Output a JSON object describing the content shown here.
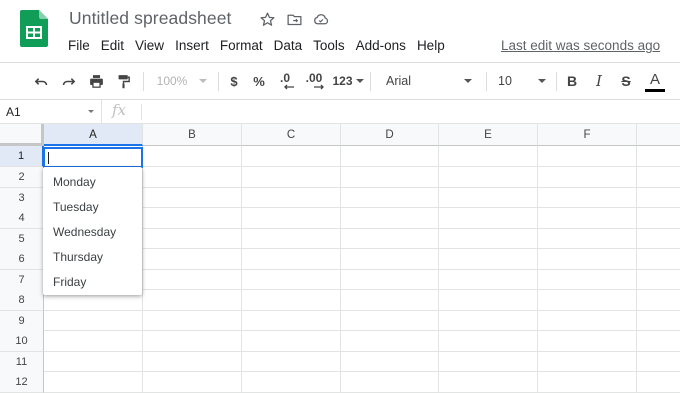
{
  "app": {
    "title": "Untitled spreadsheet",
    "last_edit": "Last edit was seconds ago",
    "brand_color": "#0f9d58"
  },
  "menu": [
    "File",
    "Edit",
    "View",
    "Insert",
    "Format",
    "Data",
    "Tools",
    "Add-ons",
    "Help"
  ],
  "toolbar": {
    "zoom": "100%",
    "currency": "$",
    "percent": "%",
    "decrease_decimal": ".0",
    "increase_decimal": ".00",
    "more_formats": "123",
    "font": "Arial",
    "font_size": "10",
    "bold": "B",
    "italic": "I",
    "strikethrough": "S",
    "text_color": "A"
  },
  "formula_bar": {
    "name_box": "A1",
    "fx_label": "fx",
    "value": ""
  },
  "grid": {
    "columns": [
      "A",
      "B",
      "C",
      "D",
      "E",
      "F"
    ],
    "rows": [
      "1",
      "2",
      "3",
      "4",
      "5",
      "6",
      "7",
      "8",
      "9",
      "10",
      "11",
      "12"
    ],
    "selected_column": "A",
    "selected_row": "1",
    "accent_color": "#1a73e8"
  },
  "dropdown": {
    "items": [
      "Monday",
      "Tuesday",
      "Wednesday",
      "Thursday",
      "Friday"
    ]
  }
}
